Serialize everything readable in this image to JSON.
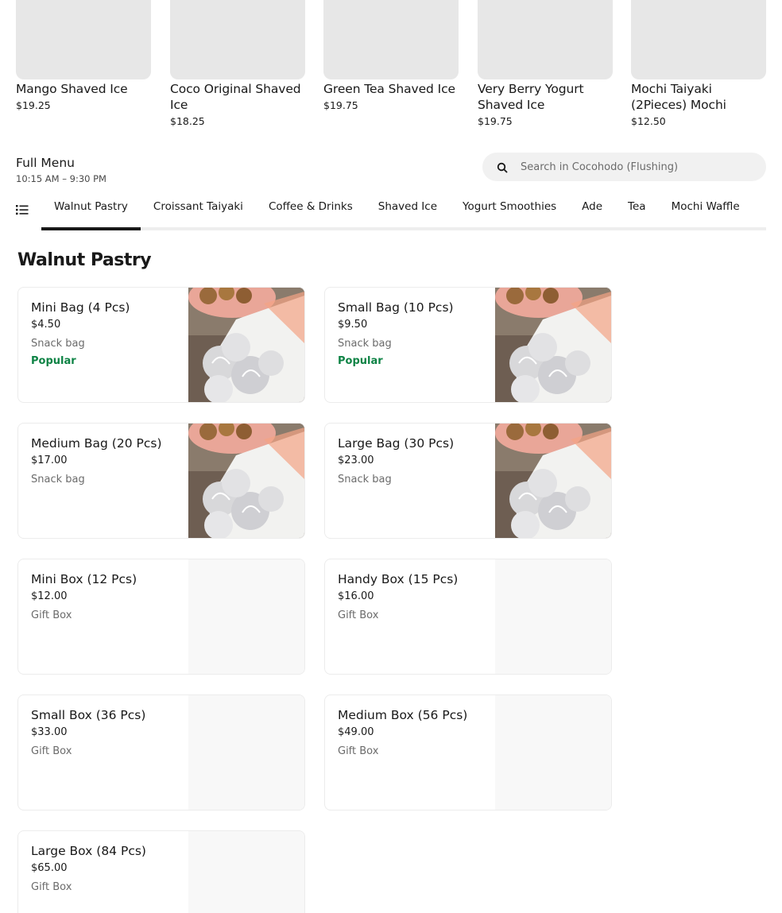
{
  "featured": [
    {
      "name": "Mango Shaved Ice",
      "price": "$19.25"
    },
    {
      "name": "Coco Original Shaved Ice",
      "price": "$18.25"
    },
    {
      "name": "Green Tea Shaved Ice",
      "price": "$19.75"
    },
    {
      "name": "Very Berry Yogurt Shaved Ice",
      "price": "$19.75"
    },
    {
      "name": "Mochi Taiyaki (2Pieces) Mochi",
      "price": "$12.50"
    }
  ],
  "menu": {
    "title": "Full Menu",
    "hours": "10:15 AM – 9:30 PM"
  },
  "search": {
    "placeholder": "Search in Cocohodo (Flushing)",
    "icon": "search-icon"
  },
  "tabs": {
    "active_index": 0,
    "items": [
      "Walnut Pastry",
      "Croissant Taiyaki",
      "Coffee & Drinks",
      "Shaved Ice",
      "Yogurt Smoothies",
      "Ade",
      "Tea",
      "Mochi Waffle"
    ]
  },
  "section": {
    "title": "Walnut Pastry",
    "items": [
      {
        "name": "Mini Bag (4 Pcs)",
        "price": "$4.50",
        "desc": "Snack bag",
        "badge": "Popular",
        "has_photo": true
      },
      {
        "name": "Small Bag (10 Pcs)",
        "price": "$9.50",
        "desc": "Snack bag",
        "badge": "Popular",
        "has_photo": true
      },
      {
        "name": "Medium Bag (20 Pcs)",
        "price": "$17.00",
        "desc": "Snack bag",
        "badge": "",
        "has_photo": true
      },
      {
        "name": "Large Bag (30 Pcs)",
        "price": "$23.00",
        "desc": "Snack bag",
        "badge": "",
        "has_photo": true
      },
      {
        "name": "Mini Box (12 Pcs)",
        "price": "$12.00",
        "desc": "Gift Box",
        "badge": "",
        "has_photo": false
      },
      {
        "name": "Handy Box (15 Pcs)",
        "price": "$16.00",
        "desc": "Gift Box",
        "badge": "",
        "has_photo": false
      },
      {
        "name": "Small Box (36 Pcs)",
        "price": "$33.00",
        "desc": "Gift Box",
        "badge": "",
        "has_photo": false
      },
      {
        "name": "Medium Box (56 Pcs)",
        "price": "$49.00",
        "desc": "Gift Box",
        "badge": "",
        "has_photo": false
      },
      {
        "name": "Large Box (84 Pcs)",
        "price": "$65.00",
        "desc": "Gift Box",
        "badge": "",
        "has_photo": false
      }
    ]
  },
  "colors": {
    "popular": "#0e8345",
    "tab_active": "#191919",
    "placeholder_bg": "#e7e7e7"
  }
}
